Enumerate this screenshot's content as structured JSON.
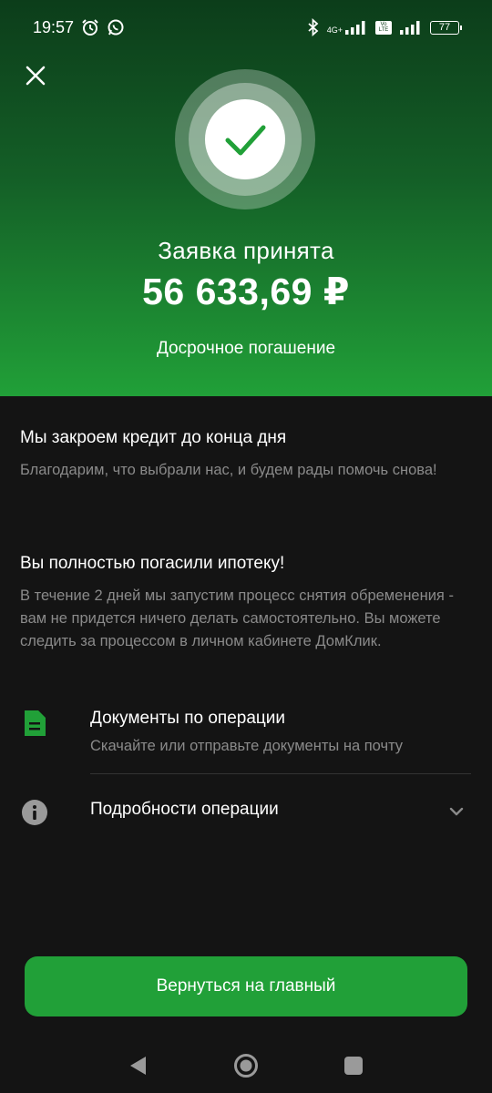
{
  "status_bar": {
    "time": "19:57",
    "network_label": "4G+",
    "volte_label": "Vo LTE",
    "battery_level": "77"
  },
  "header": {
    "title": "Заявка принята",
    "amount": "56 633,69 ₽",
    "subtitle": "Досрочное погашение"
  },
  "info": [
    {
      "heading": "Мы закроем кредит до конца дня",
      "text": "Благодарим, что выбрали нас, и будем рады помочь снова!"
    },
    {
      "heading": "Вы полностью погасили ипотеку!",
      "text": "В течение 2 дней мы запустим процесс снятия обременения - вам не придется ничего делать самостоятельно. Вы можете следить за процессом в личном кабинете ДомКлик."
    }
  ],
  "documents": {
    "title": "Документы по операции",
    "subtitle": "Скачайте или отправьте документы на почту"
  },
  "details": {
    "title": "Подробности операции"
  },
  "main_button": {
    "label": "Вернуться на главный"
  },
  "colors": {
    "accent": "#21a038",
    "background": "#141414",
    "secondary_text": "#8a8a8a"
  }
}
